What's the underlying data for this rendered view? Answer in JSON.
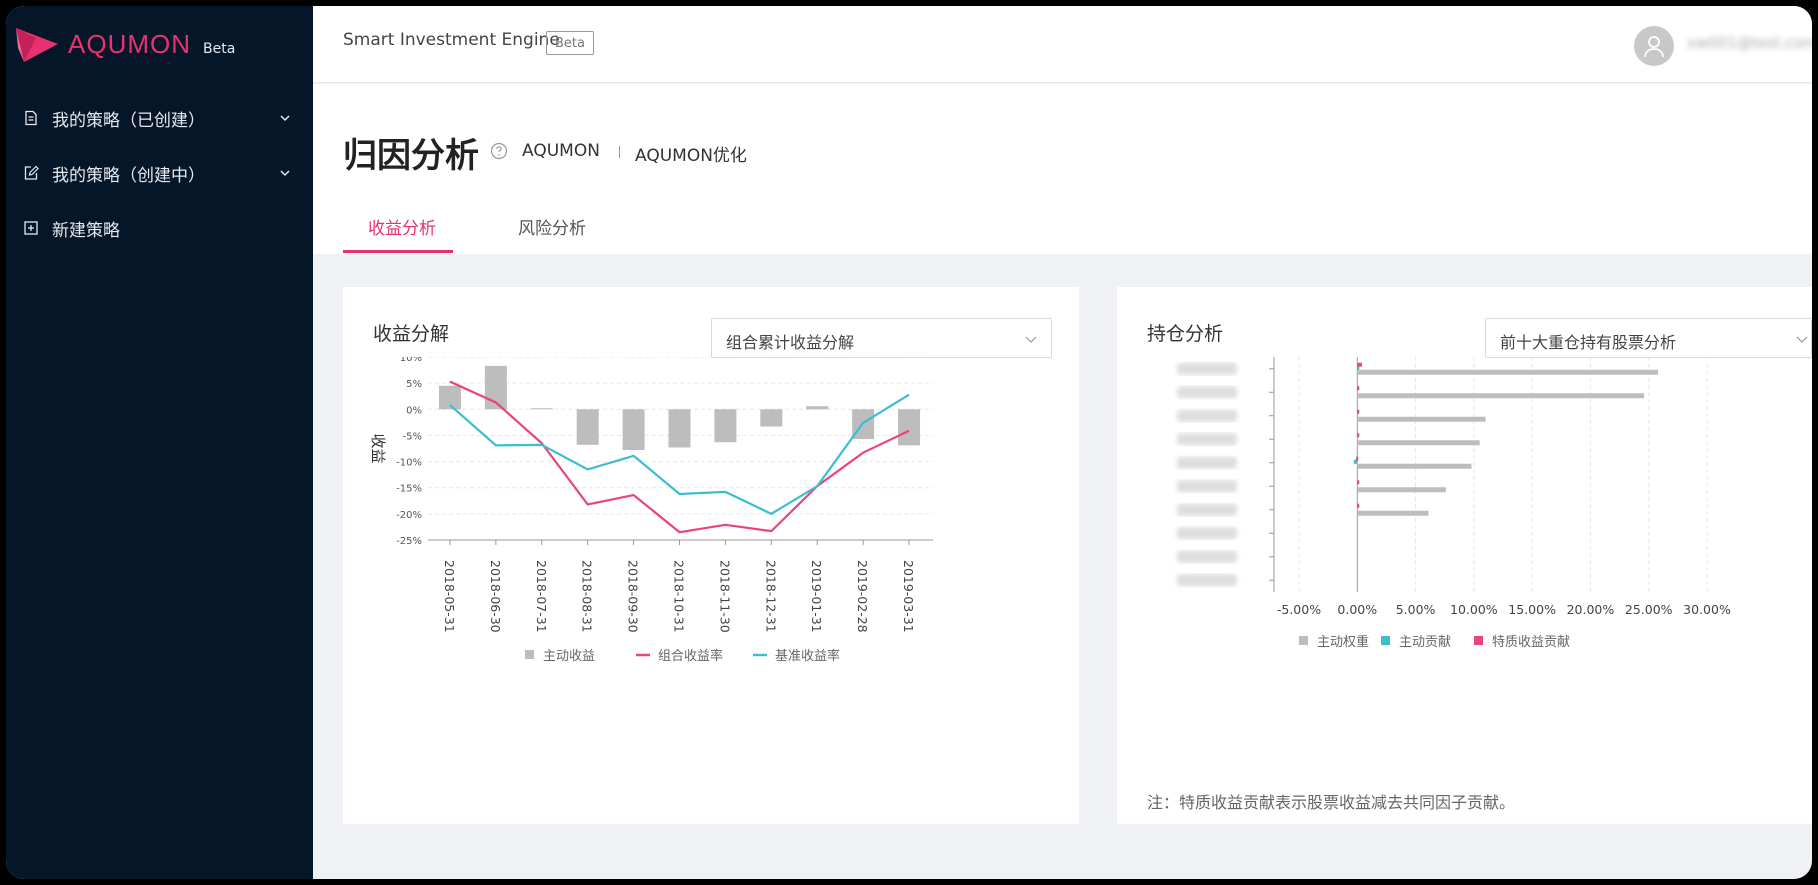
{
  "brand": {
    "name": "AQUMON",
    "beta": "Beta",
    "accent": "#e8326f",
    "sidebar_bg": "#061629"
  },
  "sidebar": {
    "items": [
      {
        "label": "我的策略（已创建）",
        "icon": "document-icon",
        "expandable": true
      },
      {
        "label": "我的策略（创建中）",
        "icon": "edit-icon",
        "expandable": true
      },
      {
        "label": "新建策略",
        "icon": "plus-square-icon",
        "expandable": false
      }
    ]
  },
  "topbar": {
    "app_title": "Smart Investment Engine",
    "beta": "Beta",
    "user_name": "xw001@test.com"
  },
  "page": {
    "title": "归因分析",
    "crumb_1": "AQUMON",
    "crumb_2": "AQUMON优化",
    "tabs": [
      {
        "label": "收益分析",
        "active": true
      },
      {
        "label": "风险分析",
        "active": false
      }
    ]
  },
  "left_card": {
    "title": "收益分解",
    "select_value": "组合累计收益分解"
  },
  "right_card": {
    "title": "持仓分析",
    "select_value": "前十大重仓持有股票分析",
    "note": "注：特质收益贡献表示股票收益减去共同因子贡献。"
  },
  "chart_data": [
    {
      "type": "bar",
      "ylabel": "收益",
      "ylim": [
        -25,
        10
      ],
      "yticks": [
        "10%",
        "5%",
        "0%",
        "-5%",
        "-10%",
        "-15%",
        "-20%",
        "-25%"
      ],
      "categories": [
        "2018-05-31",
        "2018-06-30",
        "2018-07-31",
        "2018-08-31",
        "2018-09-30",
        "2018-10-31",
        "2018-11-30",
        "2018-12-31",
        "2019-01-31",
        "2019-02-28",
        "2019-03-31"
      ],
      "series": [
        {
          "name": "主动收益",
          "type": "bar",
          "color": "#bdbdbd",
          "values": [
            4.5,
            8.3,
            0.2,
            -6.8,
            -7.8,
            -7.3,
            -6.3,
            -3.3,
            0.6,
            -5.7,
            -6.9
          ]
        },
        {
          "name": "组合收益率",
          "type": "line",
          "color": "#e8457e",
          "values": [
            5.3,
            1.3,
            -6.5,
            -18.2,
            -16.4,
            -23.5,
            -22.1,
            -23.3,
            -14.7,
            -8.3,
            -4.1
          ]
        },
        {
          "name": "基准收益率",
          "type": "line",
          "color": "#3cbdd1",
          "values": [
            0.8,
            -6.9,
            -6.8,
            -11.5,
            -8.9,
            -16.2,
            -15.8,
            -20.0,
            -14.7,
            -2.6,
            2.8
          ]
        }
      ],
      "grid": true,
      "legend": "bottom"
    },
    {
      "type": "bar",
      "orientation": "horizontal",
      "categories": [
        "",
        "",
        "",
        "",
        "",
        "",
        "",
        "",
        "",
        ""
      ],
      "xlim": [
        -5,
        30
      ],
      "xticks": [
        "-5.00%",
        "0.00%",
        "5.00%",
        "10.00%",
        "15.00%",
        "20.00%",
        "25.00%",
        "30.00%"
      ],
      "series": [
        {
          "name": "主动权重",
          "color": "#bdbdbd",
          "values": [
            25.8,
            24.6,
            11.0,
            10.5,
            9.8,
            7.6,
            6.1,
            0,
            0,
            0
          ]
        },
        {
          "name": "主动贡献",
          "color": "#3cbdd1",
          "values": [
            0.15,
            0,
            0,
            0,
            -0.3,
            0,
            0,
            0,
            0,
            0
          ]
        },
        {
          "name": "特质收益贡献",
          "color": "#e8457e",
          "values": [
            0.4,
            0.1,
            0.15,
            0.08,
            -0.1,
            0.12,
            0.05,
            0,
            0,
            0
          ]
        }
      ],
      "grid": true,
      "legend": "bottom"
    }
  ]
}
